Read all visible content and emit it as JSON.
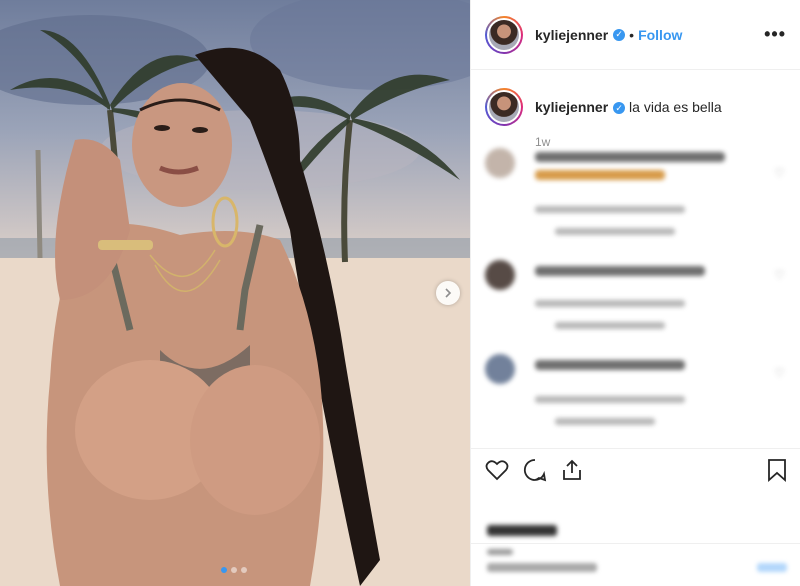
{
  "post": {
    "username": "kyliejenner",
    "follow_label": "Follow",
    "separator": "•",
    "more_icon": "more-horizontal-icon",
    "caption": "la vida es bella",
    "age": "1w",
    "carousel": {
      "total_slides": 3,
      "active_slide": 1
    }
  },
  "colors": {
    "accent": "#3897f0",
    "text": "#262626",
    "muted": "#8e8e8e",
    "divider": "#efefef"
  },
  "icons": {
    "like": "heart-icon",
    "comment": "comment-icon",
    "share": "share-icon",
    "save": "bookmark-icon",
    "next": "chevron-right-icon",
    "verified": "verified-badge-icon"
  }
}
